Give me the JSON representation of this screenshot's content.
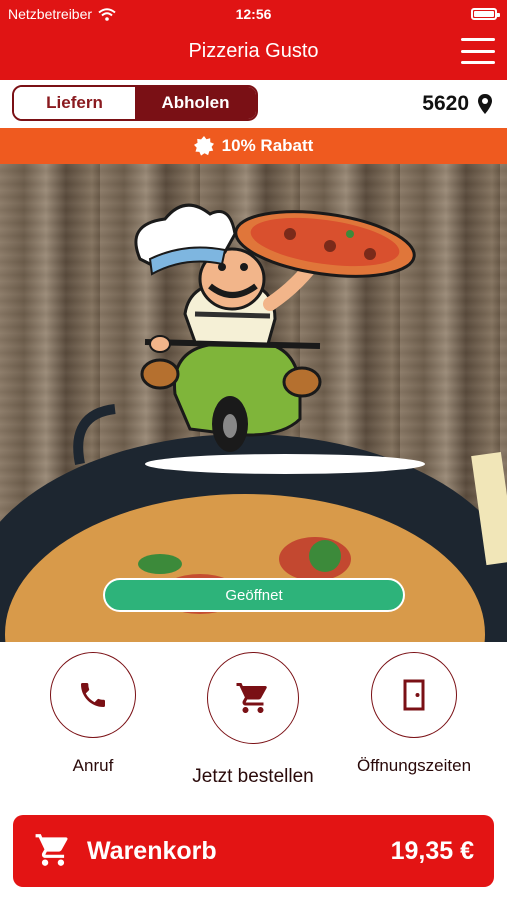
{
  "status": {
    "carrier": "Netzbetreiber",
    "time": "12:56"
  },
  "header": {
    "title": "Pizzeria Gusto",
    "menu_icon": "hamburger-menu-icon"
  },
  "mode_toggle": {
    "deliver": "Liefern",
    "pickup": "Abholen",
    "selected": "Abholen"
  },
  "location": {
    "postcode": "5620",
    "icon": "location-pin-icon"
  },
  "promo": {
    "text": "10% Rabatt",
    "icon": "badge-icon"
  },
  "hero": {
    "status": "Geöffnet"
  },
  "actions": [
    {
      "label": "Anruf",
      "icon": "phone-icon"
    },
    {
      "label": "Jetzt bestellen",
      "icon": "cart-icon"
    },
    {
      "label": "Öffnungszeiten",
      "icon": "door-icon"
    }
  ],
  "cart": {
    "title": "Warenkorb",
    "total": "19,35 €",
    "icon": "cart-icon"
  },
  "colors": {
    "header": "#e01414",
    "accent_dark": "#7a1015",
    "promo": "#ef5a1f",
    "open": "#2db37a",
    "cart": "#e31414"
  }
}
